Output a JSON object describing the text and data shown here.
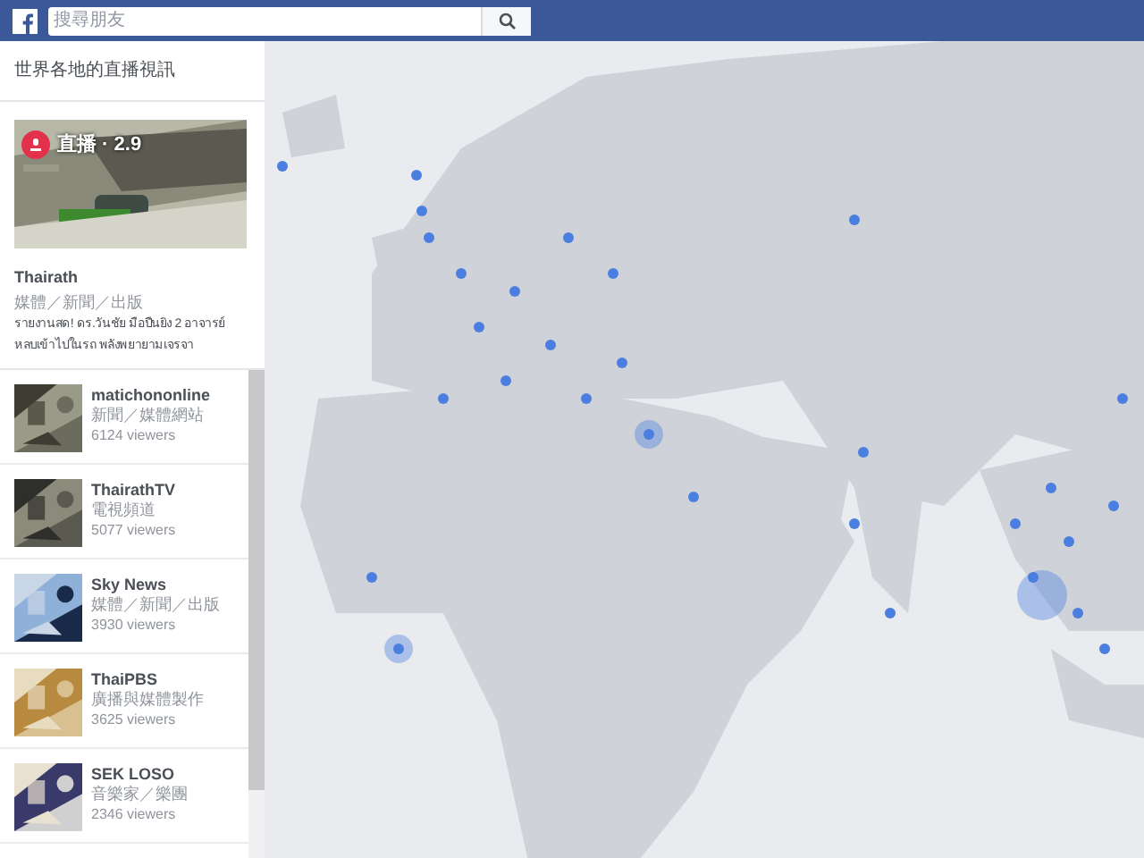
{
  "search": {
    "placeholder": "搜尋朋友"
  },
  "sidebar": {
    "title": "世界各地的直播視訊",
    "featured": {
      "badge": "直播 · 2.9",
      "name": "Thairath",
      "category": "媒體／新聞／出版",
      "description": "รายงานสด! ดร.วันชัย มือปืนยิง 2 อาจารย์ หลบเข้าไปในรถ พลังพยายามเจรจา"
    },
    "items": [
      {
        "name": "matichononline",
        "category": "新聞／媒體網站",
        "viewers": "6124 viewers"
      },
      {
        "name": "ThairathTV",
        "category": "電視頻道",
        "viewers": "5077 viewers"
      },
      {
        "name": "Sky News",
        "category": "媒體／新聞／出版",
        "viewers": "3930 viewers"
      },
      {
        "name": "ThaiPBS",
        "category": "廣播與媒體製作",
        "viewers": "3625 viewers"
      },
      {
        "name": "SEK LOSO",
        "category": "音樂家／樂團",
        "viewers": "2346 viewers"
      }
    ]
  }
}
